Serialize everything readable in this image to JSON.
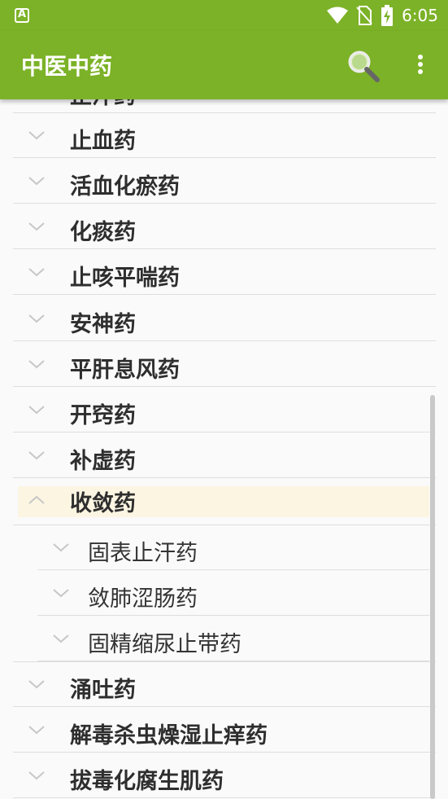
{
  "status_bar": {
    "time": "6:05"
  },
  "app_bar": {
    "title": "中医中药"
  },
  "list": {
    "partial_top": "止汗药",
    "items": [
      {
        "label": "止血药",
        "expanded": false
      },
      {
        "label": "活血化瘀药",
        "expanded": false
      },
      {
        "label": "化痰药",
        "expanded": false
      },
      {
        "label": "止咳平喘药",
        "expanded": false
      },
      {
        "label": "安神药",
        "expanded": false
      },
      {
        "label": "平肝息风药",
        "expanded": false
      },
      {
        "label": "开窍药",
        "expanded": false
      },
      {
        "label": "补虚药",
        "expanded": false
      },
      {
        "label": "收敛药",
        "expanded": true,
        "children": [
          "固表止汗药",
          "敛肺涩肠药",
          "固精缩尿止带药"
        ]
      },
      {
        "label": "涌吐药",
        "expanded": false
      },
      {
        "label": "解毒杀虫燥湿止痒药",
        "expanded": false
      },
      {
        "label": "拔毒化腐生肌药",
        "expanded": false
      }
    ]
  },
  "colors": {
    "primary": "#7cb227",
    "selected_row": "#fcf5e2",
    "divider": "#dedede"
  }
}
